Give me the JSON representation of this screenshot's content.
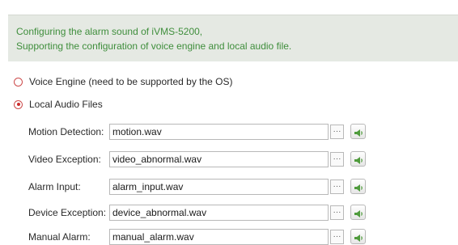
{
  "info": {
    "line1": "Configuring the alarm sound of iVMS-5200,",
    "line2": "Supporting the configuration of voice engine and local audio file."
  },
  "options": {
    "voice_engine_label": "Voice Engine (need to be supported by the OS)",
    "local_audio_label": "Local Audio Files",
    "selected": "local_audio"
  },
  "rows": [
    {
      "label": "Motion Detection:",
      "file": "motion.wav"
    },
    {
      "label": "Video Exception:",
      "file": "video_abnormal.wav"
    },
    {
      "label": "Alarm Input:",
      "file": "alarm_input.wav"
    },
    {
      "label": "Device Exception:",
      "file": "device_abnormal.wav"
    },
    {
      "label": "Manual Alarm:",
      "file": "manual_alarm.wav"
    }
  ],
  "buttons": {
    "browse_label": "···",
    "browse_icon": "ellipsis-icon",
    "play_icon": "speaker-icon"
  },
  "colors": {
    "info_text": "#3f8e3c",
    "info_bg": "#e5e9e3",
    "radio_accent": "#cc2b2b",
    "speaker_green": "#4f9b3c"
  }
}
